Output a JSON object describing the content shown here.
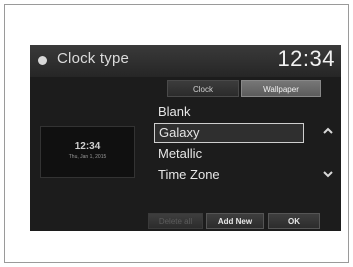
{
  "header": {
    "title": "Clock type",
    "time": "12:34"
  },
  "tabs": [
    {
      "label": "Clock"
    },
    {
      "label": "Wallpaper"
    }
  ],
  "preview": {
    "time": "12:34",
    "date": "Thu, Jan 1, 2015"
  },
  "options": [
    {
      "label": "Blank",
      "selected": false
    },
    {
      "label": "Galaxy",
      "selected": true
    },
    {
      "label": "Metallic",
      "selected": false
    },
    {
      "label": "Time Zone",
      "selected": false
    }
  ],
  "footer": {
    "delete_label": "Delete all",
    "add_label": "Add New",
    "ok_label": "OK"
  },
  "icons": {
    "scroll_up": "chevron-up-icon",
    "scroll_down": "chevron-down-icon"
  }
}
